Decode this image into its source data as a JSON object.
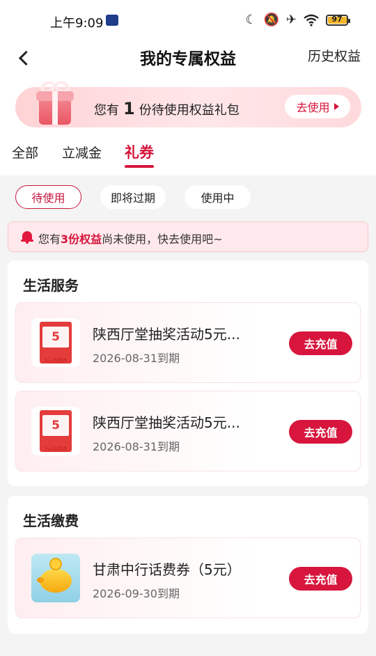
{
  "status_bar": {
    "time": "上午9:09",
    "battery": "97",
    "icons": [
      "moon-icon",
      "bell-off-icon",
      "airplane-icon",
      "wifi-icon",
      "battery-icon"
    ]
  },
  "header": {
    "title": "我的专属权益",
    "history": "历史权益",
    "back_icon": "chevron-left-icon"
  },
  "banner": {
    "prefix": "您有",
    "count": "1",
    "suffix": "份待使用权益礼包",
    "button": "去使用"
  },
  "tabs": [
    {
      "label": "全部",
      "active": false
    },
    {
      "label": "立减金",
      "active": false
    },
    {
      "label": "礼券",
      "active": true
    }
  ],
  "filters": [
    {
      "label": "待使用",
      "active": true
    },
    {
      "label": "即将过期",
      "active": false
    },
    {
      "label": "使用中",
      "active": false
    }
  ],
  "notice": {
    "prefix": "您有",
    "highlight": "3份权益",
    "suffix": "尚未使用，快去使用吧~"
  },
  "sections": [
    {
      "title": "生活服务",
      "items": [
        {
          "title": "陕西厅堂抽奖活动5元...",
          "date": "2026-08-31到期",
          "button": "去充值",
          "thumb_value": "5",
          "thumb_caption": "5元话费券"
        },
        {
          "title": "陕西厅堂抽奖活动5元...",
          "date": "2026-08-31到期",
          "button": "去充值",
          "thumb_value": "5",
          "thumb_caption": "5元话费券"
        }
      ]
    },
    {
      "title": "生活缴费",
      "items": [
        {
          "title": "甘肃中行话费券（5元）",
          "date": "2026-09-30到期",
          "button": "去充值"
        }
      ]
    }
  ],
  "colors": {
    "accent": "#d6143a",
    "background": "#f4f4f4",
    "notice_bg": "#ffe9ec"
  }
}
